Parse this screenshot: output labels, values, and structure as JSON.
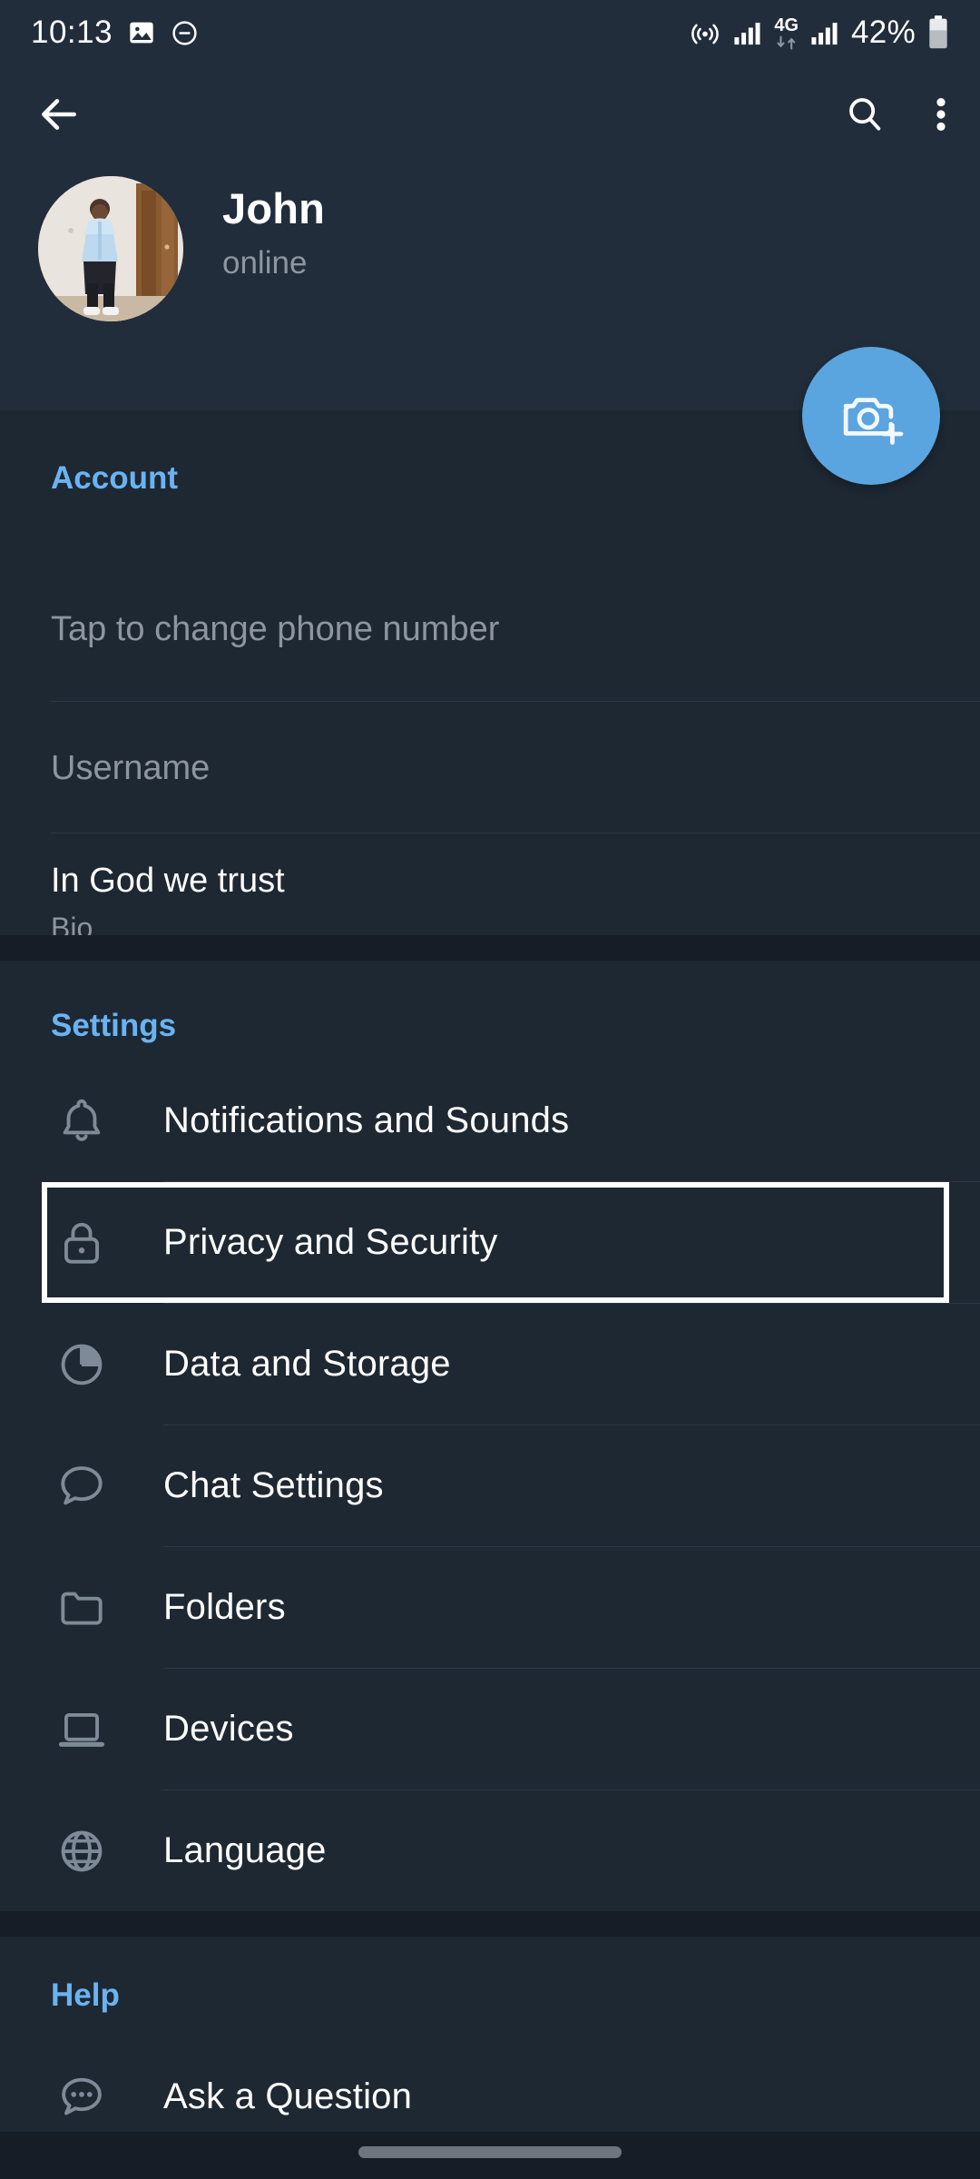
{
  "status_bar": {
    "time": "10:13",
    "battery_percent": "42%",
    "network_label": "4G",
    "icons": [
      "image-icon",
      "do-not-disturb-icon",
      "hotspot-icon",
      "signal-bars-icon",
      "4g-data-icon",
      "signal-bars-2-icon",
      "battery-icon"
    ]
  },
  "toolbar": {
    "back_icon": "back-arrow-icon",
    "search_icon": "search-icon",
    "overflow_icon": "more-vertical-icon"
  },
  "profile": {
    "name": "John",
    "status": "online",
    "avatar_alt": "user-profile-photo",
    "fab_icon": "camera-plus-icon",
    "fab_color": "#5aa5e0"
  },
  "account": {
    "title": "Account",
    "rows": [
      {
        "primary": "",
        "placeholder": "Tap to change phone number",
        "sub": ""
      },
      {
        "primary": "",
        "placeholder": "Username",
        "sub": ""
      },
      {
        "primary": "In God we trust",
        "placeholder": "",
        "sub": "Bio"
      }
    ]
  },
  "settings": {
    "title": "Settings",
    "items": [
      {
        "label": "Notifications and Sounds",
        "icon": "bell-icon",
        "selected": false
      },
      {
        "label": "Privacy and Security",
        "icon": "lock-icon",
        "selected": true
      },
      {
        "label": "Data and Storage",
        "icon": "pie-chart-icon",
        "selected": false
      },
      {
        "label": "Chat Settings",
        "icon": "speech-bubble-icon",
        "selected": false
      },
      {
        "label": "Folders",
        "icon": "folder-icon",
        "selected": false
      },
      {
        "label": "Devices",
        "icon": "laptop-icon",
        "selected": false
      },
      {
        "label": "Language",
        "icon": "globe-icon",
        "selected": false
      }
    ]
  },
  "help": {
    "title": "Help",
    "items": [
      {
        "label": "Ask a Question",
        "icon": "question-bubble-icon"
      }
    ]
  },
  "colors": {
    "background": "#1e2832",
    "header_background": "#212d3b",
    "accent_blue": "#6ab3f3",
    "divider": "#2b3743",
    "muted_text": "#8d969f",
    "icon_gray": "#7e8a97",
    "highlight_border": "#ffffff"
  },
  "nav_bar": {
    "gesture_pill": "home-gesture-pill"
  }
}
